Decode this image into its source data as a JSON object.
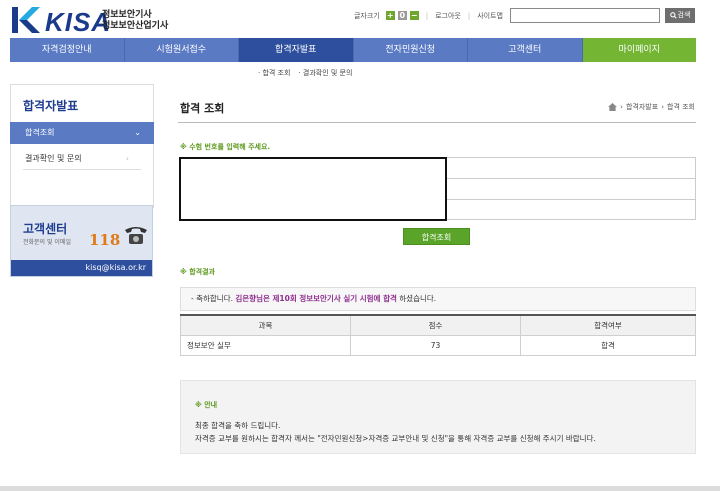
{
  "header": {
    "logo_text": "KISA",
    "logo_sub1": "정보보안기사",
    "logo_sub2": "정보보안산업기사",
    "font_size_label": "글자크기",
    "font_plus": "+",
    "font_reset": "0",
    "font_minus": "−",
    "logout": "로그아웃",
    "sitemap": "사이트맵",
    "search_value": "",
    "search_button": "검색"
  },
  "nav": {
    "items": [
      "자격검정안내",
      "시험원서접수",
      "합격자발표",
      "전자민원신청",
      "고객센터",
      "마이페이지"
    ]
  },
  "subnav": [
    "· 합격 조회",
    "· 결과확인 및 문의"
  ],
  "sidebar": {
    "title": "합격자발표",
    "items": [
      "합격조회",
      "결과확인 및 문의"
    ],
    "cs": {
      "title": "고객센터",
      "subtitle": "전화문의 및 이메일",
      "number": "118",
      "email": "kisq@kisa.or.kr"
    }
  },
  "main": {
    "title": "합격 조회",
    "breadcrumb": [
      "합격자발표",
      "합격 조회"
    ],
    "instruction": "※ 수험 번호를 입력해 주세요.",
    "query_button": "합격조회",
    "result_label": "※ 합격결과",
    "message_prefix": "- 축하합니다.",
    "message_highlight": "김은향님은 제10회 정보보안기사 실기 시험에 합격",
    "message_suffix": "하셨습니다.",
    "table": {
      "headers": [
        "과목",
        "점수",
        "합격여부"
      ],
      "rows": [
        [
          "정보보안 실무",
          "73",
          "합격"
        ]
      ]
    },
    "notice": {
      "title": "※ 안내",
      "line1": "최종 합격을 축하 드립니다.",
      "line2": "자격증 교부를 원하시는 합격자 께서는 \"전자민원신청>자격증 교부안내 및 신청\"을 통해 자격증 교부를 신청해 주시기 바랍니다."
    }
  },
  "colors": {
    "nav_blue": "#5b7ac4",
    "nav_active": "#2e4f9e",
    "mypage_green": "#74b534",
    "accent_green": "#5f9a21",
    "highlight_purple": "#8f2e8f"
  }
}
